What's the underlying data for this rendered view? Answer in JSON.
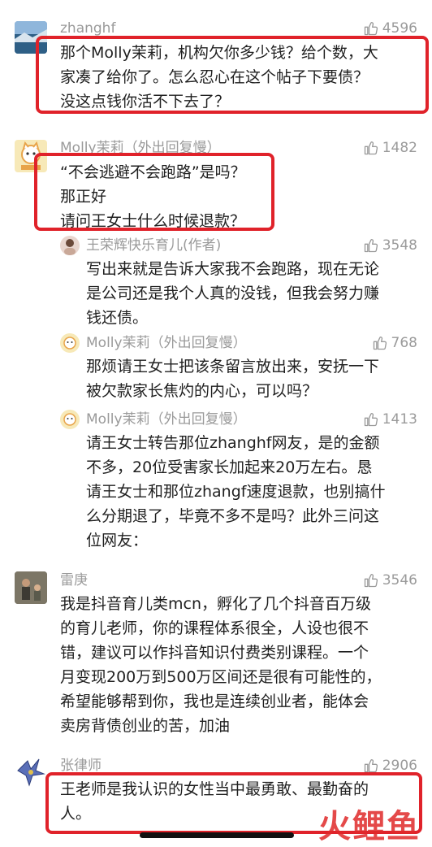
{
  "comments": [
    {
      "author": "zhanghf",
      "likes": "4596",
      "text": "那个Molly茉莉，机构欠你多少钱？给个数，大\n家凑了给你了。怎么忍心在这个帖子下要债？\n没这点钱你活不下去了？"
    },
    {
      "author": "Molly茉莉（外出回复慢）",
      "likes": "1482",
      "text": "“不会逃避不会跑路”是吗？\n那正好\n请问王女士什么时候退款？"
    },
    {
      "author": "王荣辉快乐育儿(作者)",
      "likes": "3548",
      "text": "写出来就是告诉大家我不会跑路，现在无论\n是公司还是我个人真的没钱，但我会努力赚\n钱还债。"
    },
    {
      "author": "Molly茉莉（外出回复慢）",
      "likes": "768",
      "text": "那烦请王女士把该条留言放出来，安抚一下\n被欠款家长焦灼的内心，可以吗？"
    },
    {
      "author": "Molly茉莉（外出回复慢）",
      "likes": "1413",
      "text": "请王女士转告那位zhanghf网友，是的金额\n不多，20位受害家长加起来20万左右。恳\n请王女士和那位zhangf速度退款，也别搞什\n么分期退了，毕竟不多不是吗？此外三问这\n位网友："
    },
    {
      "author": "雷庚",
      "likes": "3546",
      "text": "我是抖音育儿类mcn，孵化了几个抖音百万级\n的育儿老师，你的课程体系很全，人设也很不\n错，建议可以作抖音知识付费类别课程。一个\n月变现200万到500万区间还是很有可能性的，\n希望能够帮到你，我也是连续创业者，能体会\n卖房背债创业的苦，加油"
    },
    {
      "author": "张律师",
      "likes": "2906",
      "text": "王老师是我认识的女性当中最勇敢、最勤奋的\n人。"
    }
  ],
  "watermark": "火鲤鱼",
  "colors": {
    "highlight": "#e0222a",
    "meta": "#9a9a9a",
    "text": "#1f1f1f"
  }
}
